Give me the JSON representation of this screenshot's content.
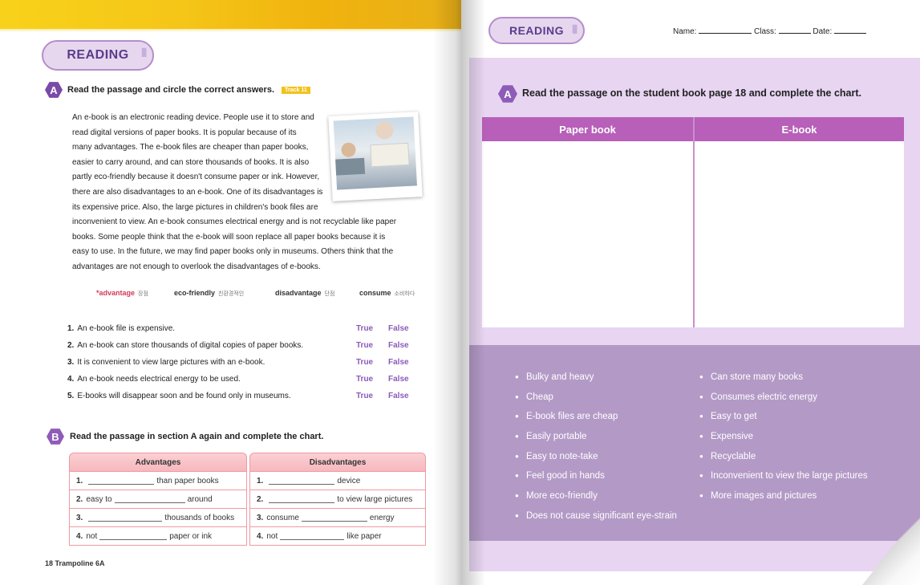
{
  "left_page": {
    "section_badge": "READING",
    "instruction_a": {
      "marker": "A",
      "text": "Read the passage and circle the correct answers.",
      "track": "Track 11"
    },
    "passage_lines": [
      "An e-book is an electronic reading device. People use it to store and",
      "read digital versions of paper books. It is popular because of its",
      "many advantages. The e-book files are cheaper than paper books,",
      "easier to carry around, and can store thousands of books. It is also",
      "partly eco-friendly because it doesn't consume paper or ink. However,",
      "there are also disadvantages to an e-book. One of its disadvantages is",
      "its expensive price. Also, the large pictures in children's book files are",
      "inconvenient to view. An e-book consumes electrical energy and is not recyclable like paper",
      "books. Some people think that the e-book will soon replace all paper books because it is",
      "easy to use. In the future, we may find paper books only in museums. Others think that the",
      "advantages are not enough to overlook the disadvantages of e-books."
    ],
    "vocab": [
      {
        "word": "*advantage",
        "gloss": "장점"
      },
      {
        "word": "eco-friendly",
        "gloss": "친환경적인"
      },
      {
        "word": "disadvantage",
        "gloss": "단점"
      },
      {
        "word": "consume",
        "gloss": "소비하다"
      }
    ],
    "questions": [
      {
        "num": "1.",
        "text": "An e-book file is expensive."
      },
      {
        "num": "2.",
        "text": "An e-book can store thousands of digital copies of paper books."
      },
      {
        "num": "3.",
        "text": "It is convenient to view large pictures with an e-book."
      },
      {
        "num": "4.",
        "text": "An e-book needs electrical energy to be used."
      },
      {
        "num": "5.",
        "text": "E-books will disappear soon and be found only in museums."
      }
    ],
    "true_label": "True",
    "false_label": "False",
    "instruction_b": {
      "marker": "B",
      "text": "Read the passage in section A again and complete the chart."
    },
    "table": {
      "adv_header": "Advantages",
      "dis_header": "Disadvantages",
      "adv_rows": [
        {
          "num": "1.",
          "pre": "",
          "post": "than paper books"
        },
        {
          "num": "2.",
          "pre": "easy to",
          "post": "around"
        },
        {
          "num": "3.",
          "pre": "",
          "post": "thousands of books"
        },
        {
          "num": "4.",
          "pre": "not",
          "post": "paper or ink"
        }
      ],
      "dis_rows": [
        {
          "num": "1.",
          "pre": "",
          "post": "device"
        },
        {
          "num": "2.",
          "pre": "",
          "post": "to view large pictures"
        },
        {
          "num": "3.",
          "pre": "consume",
          "post": "energy"
        },
        {
          "num": "4.",
          "pre": "not",
          "post": "like paper"
        }
      ]
    },
    "footer": "18  Trampoline 6A"
  },
  "right_page": {
    "section_badge": "READING",
    "name_label": "Name:",
    "class_label": "Class:",
    "date_label": "Date:",
    "instruction": {
      "marker": "A",
      "text": "Read the passage on the student book page 18 and complete the chart."
    },
    "chart_headers": [
      "Paper book",
      "E-book"
    ],
    "options_left": [
      "Bulky and heavy",
      "Cheap",
      "E-book files are cheap",
      "Easily portable",
      "Easy to note-take",
      "Feel good in hands",
      "More eco-friendly",
      "Does not cause significant eye-strain"
    ],
    "options_right": [
      "Can store many books",
      "Consumes electric energy",
      "Easy to get",
      "Expensive",
      "Recyclable",
      "Inconvenient to view the large pictures",
      "More images and pictures"
    ]
  },
  "colors": {
    "accent_purple": "#7a4aa8",
    "chart_header": "#b75fb9",
    "options_panel": "#b39ac6",
    "panel_light": "#e8d5f2",
    "table_pink": "#f6b8be",
    "band_yellow": "#f5c518"
  }
}
